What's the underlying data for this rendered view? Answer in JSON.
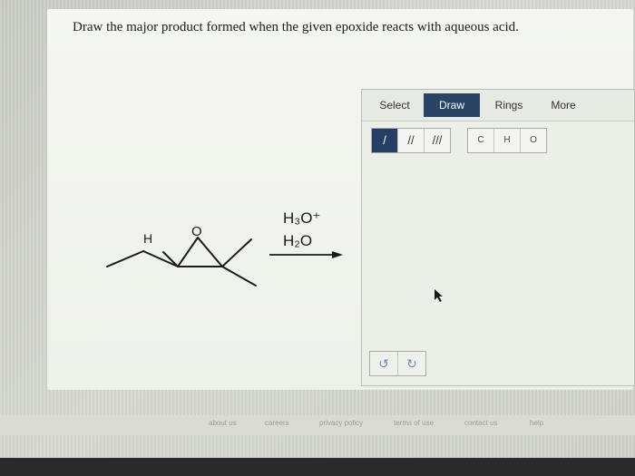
{
  "question": {
    "text": "Draw the major product formed when the given epoxide reacts with aqueous acid."
  },
  "reaction": {
    "atom_h": "H",
    "atom_o": "O",
    "reagent_1": "H₃O⁺",
    "reagent_2": "H₂O"
  },
  "toolbar": {
    "tabs": [
      {
        "label": "Select"
      },
      {
        "label": "Draw",
        "active": true
      },
      {
        "label": "Rings"
      },
      {
        "label": "More"
      }
    ],
    "bonds": [
      {
        "label": "/",
        "active": true
      },
      {
        "label": "//"
      },
      {
        "label": "///"
      }
    ],
    "atoms": [
      {
        "label": "C"
      },
      {
        "label": "H"
      },
      {
        "label": "O"
      }
    ]
  },
  "controls": {
    "undo": "↺",
    "redo": "↻"
  },
  "footer": {
    "links": [
      "about us",
      "careers",
      "privacy policy",
      "terms of use",
      "contact us",
      "help"
    ]
  },
  "colors": {
    "active_tab": "#2a4466",
    "active_bond": "#243f63",
    "undo_icon": "#6c8fb7"
  }
}
